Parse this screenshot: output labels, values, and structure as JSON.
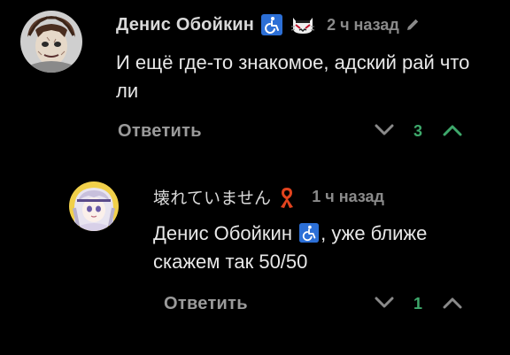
{
  "colors": {
    "background": "#000000",
    "author": "#d9d9d9",
    "muted": "#8a8a8a",
    "positive": "#3ea86b",
    "text": "#e8e8e8"
  },
  "comments": [
    {
      "author": "Денис Обойкин",
      "badges": [
        "wheelchair-badge-icon",
        "cat-badge-icon"
      ],
      "time": "2 ч назад",
      "edited_icon": "pencil-icon",
      "text": "И ещё где-то знакомое, адский рай что ли",
      "reply_label": "Ответить",
      "score": "3"
    },
    {
      "author": "壊れていません",
      "badges": [
        "ribbon-badge-icon"
      ],
      "time": "1 ч назад",
      "text_mention": "Денис Обойкин",
      "text_rest": ", уже ближе скажем так 50/50",
      "reply_label": "Ответить",
      "score": "1"
    }
  ]
}
